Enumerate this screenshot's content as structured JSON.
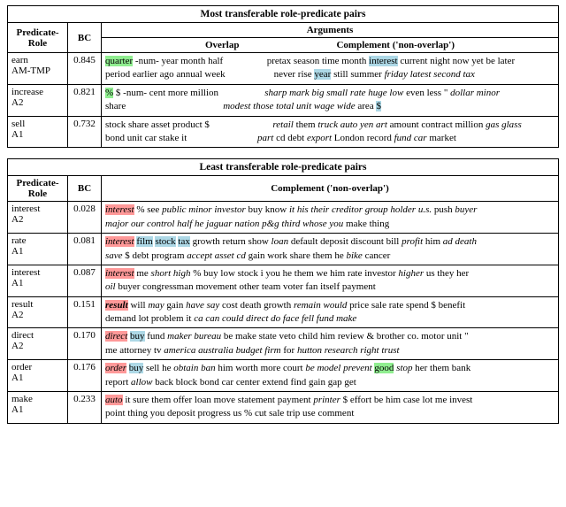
{
  "top_title": "Most transferable role-predicate pairs",
  "bottom_title": "Least transferable role-predicate pairs",
  "col_predicate_role": "Predicate-Role",
  "col_bc": "BC",
  "col_arguments": "Arguments",
  "col_overlap": "Overlap",
  "col_complement": "Complement ('non-overlap')"
}
